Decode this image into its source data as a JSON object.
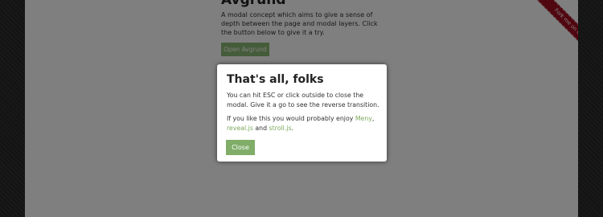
{
  "page": {
    "title": "Avgrund",
    "description": "A modal concept which aims to give a sense of depth between the page and modal layers. Click the button below to give it a try.",
    "open_button_label": "Open Avgrund",
    "ribbon_text": "Fork me on GitHub"
  },
  "modal": {
    "title": "That's all, folks",
    "paragraph1": "You can hit ESC or click outside to close the modal. Give it a go to see the reverse transition.",
    "paragraph2": {
      "intro": "If you like this you would probably enjoy ",
      "link1": "Meny",
      "sep1": ",",
      "link2": "reveal.js",
      "sep2": " and ",
      "link3": "stroll.js",
      "end": "."
    },
    "close_button_label": "Close"
  },
  "colors": {
    "background": "#2b2b2b",
    "accent": "#80ad68",
    "ribbon": "#a00f1f",
    "overlay": "rgba(0,0,0,0.5)"
  }
}
